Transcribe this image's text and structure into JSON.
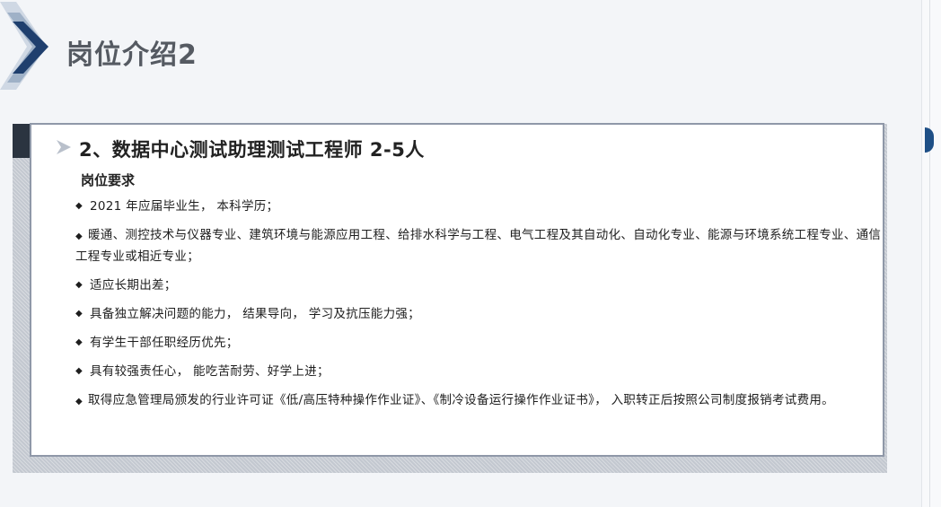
{
  "slide": {
    "title": "岗位介绍2"
  },
  "card": {
    "heading": "2、数据中心测试助理测试工程师 2-5人",
    "section_label": "岗位要求",
    "bullet_icon": "diamond-bullet",
    "requirements": [
      "2021 年应届毕业生， 本科学历；",
      "暖通、测控技术与仪器专业、建筑环境与能源应用工程、给排水科学与工程、电气工程及其自动化、自动化专业、能源与环境系统工程专业、通信工程专业或相近专业；",
      "适应长期出差；",
      "具备独立解决问题的能力， 结果导向， 学习及抗压能力强；",
      "有学生干部任职经历优先；",
      "具有较强责任心， 能吃苦耐劳、好学上进；",
      "取得应急管理局颁发的行业许可证《低/高压特种操作作业证》、《制冷设备运行操作作业证书》， 入职转正后按照公司制度报销考试费用。"
    ]
  },
  "colors": {
    "title_gray": "#555a62",
    "accent_navy": "#1e4f86",
    "card_border": "#8f98a8"
  }
}
